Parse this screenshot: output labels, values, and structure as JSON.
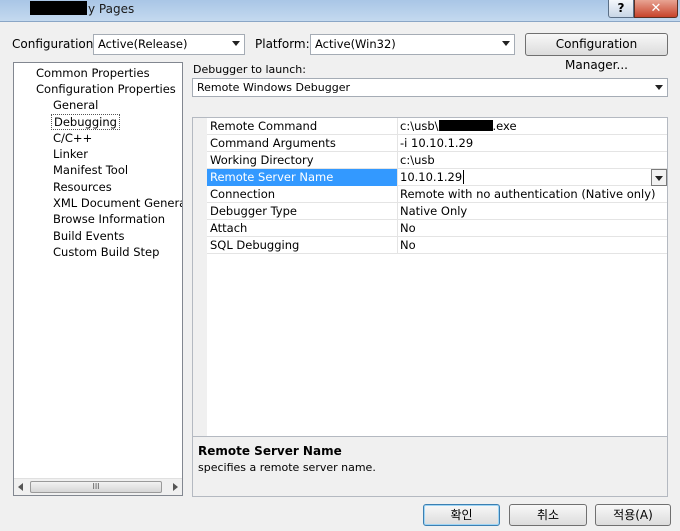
{
  "window": {
    "title_suffix": "y Pages",
    "help_glyph": "?",
    "close_glyph": "✕"
  },
  "toolbar": {
    "configuration_label": "Configuration:",
    "configuration_value": "Active(Release)",
    "platform_label": "Platform:",
    "platform_value": "Active(Win32)",
    "config_manager_label": "Configuration Manager..."
  },
  "tree": {
    "items": [
      {
        "label": "Common Properties",
        "level": 0
      },
      {
        "label": "Configuration Properties",
        "level": 0
      },
      {
        "label": "General",
        "level": 1
      },
      {
        "label": "Debugging",
        "level": 1,
        "selected": true
      },
      {
        "label": "C/C++",
        "level": 1
      },
      {
        "label": "Linker",
        "level": 1
      },
      {
        "label": "Manifest Tool",
        "level": 1
      },
      {
        "label": "Resources",
        "level": 1
      },
      {
        "label": "XML Document Generator",
        "level": 1
      },
      {
        "label": "Browse Information",
        "level": 1
      },
      {
        "label": "Build Events",
        "level": 1
      },
      {
        "label": "Custom Build Step",
        "level": 1
      }
    ],
    "scroll_thumb_glyph": "III"
  },
  "debugger": {
    "launch_label": "Debugger to launch:",
    "launch_value": "Remote Windows Debugger"
  },
  "properties": [
    {
      "name": "Remote Command",
      "value_prefix": "c:\\usb\\",
      "value_suffix": ".exe",
      "redacted": true
    },
    {
      "name": "Command Arguments",
      "value": "-i 10.10.1.29"
    },
    {
      "name": "Working Directory",
      "value": "c:\\usb"
    },
    {
      "name": "Remote Server Name",
      "value": "10.10.1.29",
      "selected": true
    },
    {
      "name": "Connection",
      "value": "Remote with no authentication (Native only)"
    },
    {
      "name": "Debugger Type",
      "value": "Native Only"
    },
    {
      "name": "Attach",
      "value": "No"
    },
    {
      "name": "SQL Debugging",
      "value": "No"
    }
  ],
  "description": {
    "title": "Remote Server Name",
    "text": "specifies a remote server name."
  },
  "buttons": {
    "ok": "확인",
    "cancel": "취소",
    "apply": "적용(A)"
  },
  "colors": {
    "selection": "#3399ff",
    "close_button": "#c7432b"
  }
}
